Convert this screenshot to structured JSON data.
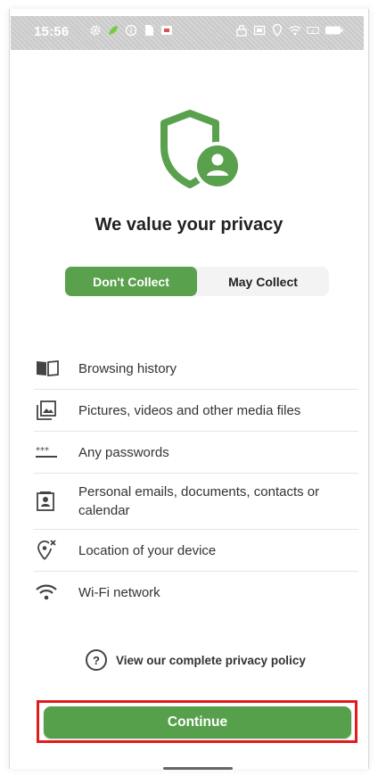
{
  "status": {
    "time": "15:56"
  },
  "title": "We value your privacy",
  "tabs": [
    {
      "label": "Don't Collect",
      "active": true
    },
    {
      "label": "May Collect",
      "active": false
    }
  ],
  "items": [
    {
      "icon": "book-icon",
      "label": "Browsing history"
    },
    {
      "icon": "image-gallery-icon",
      "label": "Pictures, videos and other media files"
    },
    {
      "icon": "password-icon",
      "label": "Any passwords"
    },
    {
      "icon": "contact-card-icon",
      "label": "Personal emails, documents, contacts or calendar"
    },
    {
      "icon": "location-off-icon",
      "label": "Location of your device"
    },
    {
      "icon": "wifi-icon",
      "label": "Wi-Fi network"
    }
  ],
  "policy_link": "View our complete privacy policy",
  "continue_label": "Continue",
  "colors": {
    "accent": "#5aa14e",
    "highlight": "#e21b1b"
  }
}
